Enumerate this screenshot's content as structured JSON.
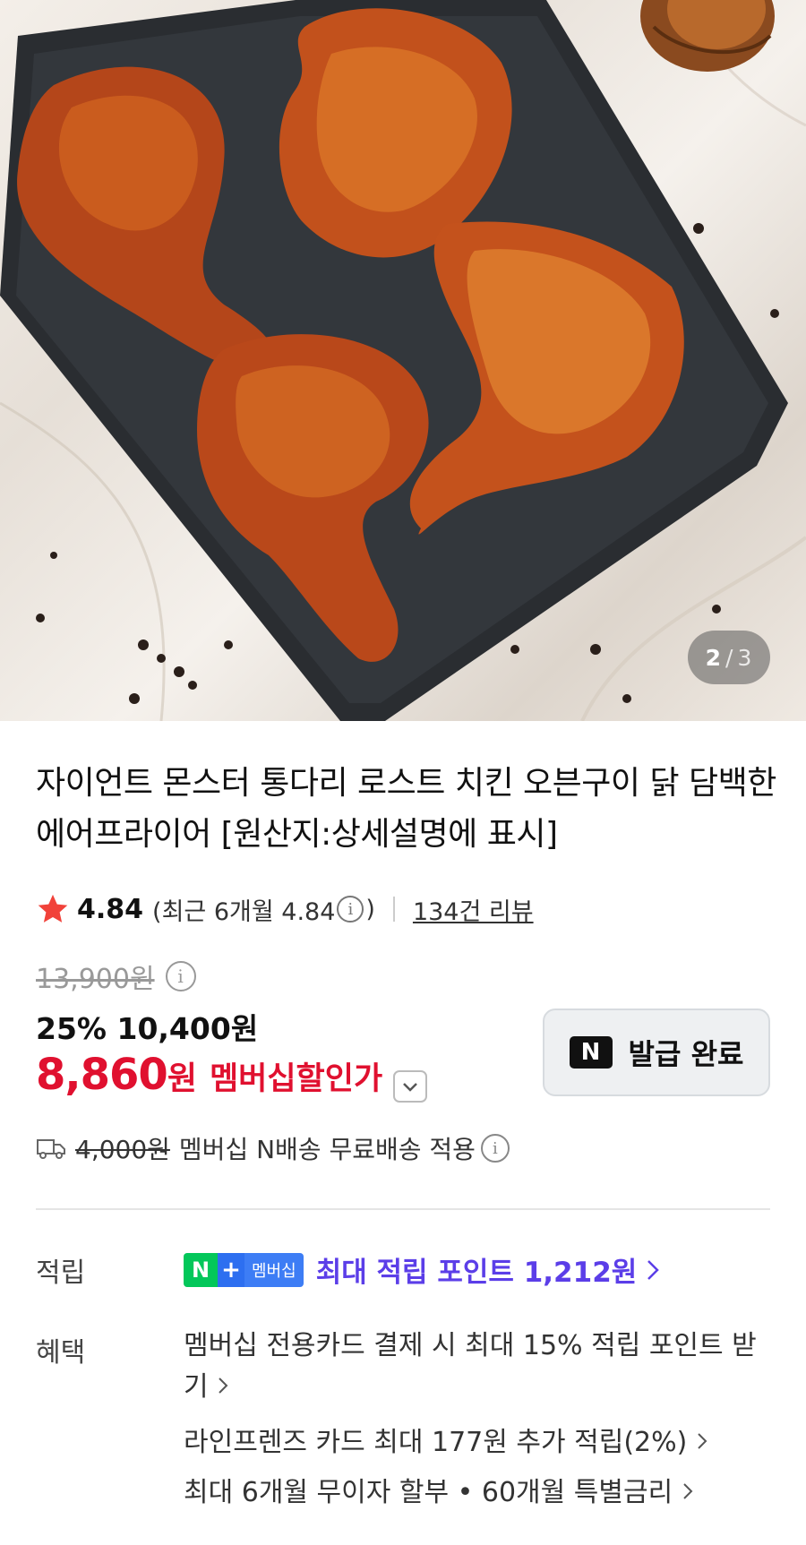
{
  "gallery": {
    "current": "2",
    "separator": "/",
    "total": "3"
  },
  "product": {
    "title": "자이언트 몬스터 통다리 로스트 치킨 오븐구이 닭 담백한 에어프라이어 [원산지:상세설명에 표시]"
  },
  "rating": {
    "score": "4.84",
    "recent_prefix": "(최근 6개월 4.84",
    "recent_suffix": ")",
    "reviews": "134건 리뷰"
  },
  "price": {
    "original": "13,900원",
    "discount_line": "25% 10,400원",
    "member_price": "8,860",
    "won": "원",
    "member_label": "멤버십할인가"
  },
  "coupon": {
    "logo": "N",
    "label": "발급 완료"
  },
  "shipping": {
    "old_fee": "4,000원",
    "text": "멤버십 N배송 무료배송 적용"
  },
  "points": {
    "label": "적립",
    "badge_n": "N",
    "badge_plus": "+",
    "badge_member": "멤버십",
    "text": "최대 적립 포인트 1,212원"
  },
  "benefits": {
    "label": "혜택",
    "items": [
      "멤버십 전용카드 결제 시 최대 15% 적립 포인트 받기",
      "라인프렌즈 카드 최대 177원 추가 적립(2%)",
      "최대 6개월 무이자 할부 • 60개월 특별금리"
    ]
  },
  "colors": {
    "sale_red": "#e0102f",
    "points_purple": "#5b3ee8",
    "naver_green": "#03c75a"
  },
  "icons": [
    "star-icon",
    "info-icon",
    "chevron-down-icon",
    "truck-icon",
    "chevron-right-icon",
    "naver-n-icon"
  ]
}
